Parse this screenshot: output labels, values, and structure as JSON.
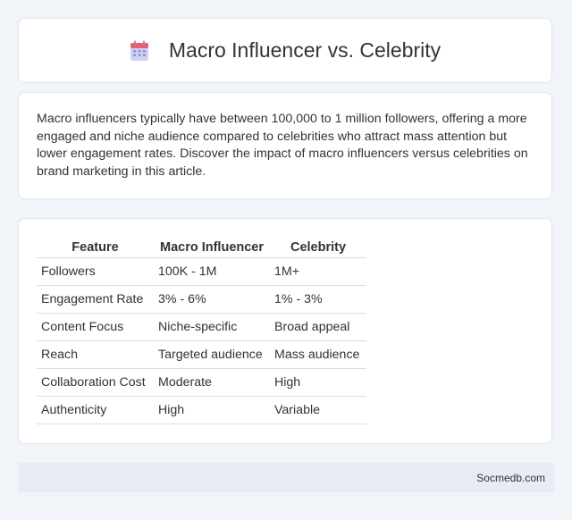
{
  "header": {
    "title": "Macro Influencer vs. Celebrity",
    "icon": "calendar-icon"
  },
  "intro": {
    "text": "Macro influencers typically have between 100,000 to 1 million followers, offering a more engaged and niche audience compared to celebrities who attract mass attention but lower engagement rates. Discover the impact of macro influencers versus celebrities on brand marketing in this article."
  },
  "table": {
    "headers": [
      "Feature",
      "Macro Influencer",
      "Celebrity"
    ],
    "rows": [
      [
        "Followers",
        "100K - 1M",
        "1M+"
      ],
      [
        "Engagement Rate",
        "3% - 6%",
        "1% - 3%"
      ],
      [
        "Content Focus",
        "Niche-specific",
        "Broad appeal"
      ],
      [
        "Reach",
        "Targeted audience",
        "Mass audience"
      ],
      [
        "Collaboration Cost",
        "Moderate",
        "High"
      ],
      [
        "Authenticity",
        "High",
        "Variable"
      ]
    ]
  },
  "footer": {
    "site": "Socmedb.com"
  },
  "colors": {
    "background": "#f1f4f9",
    "card": "#ffffff",
    "footer": "#e6ebf4",
    "icon_top": "#ef6b6b",
    "icon_body": "#c9cdf0"
  }
}
